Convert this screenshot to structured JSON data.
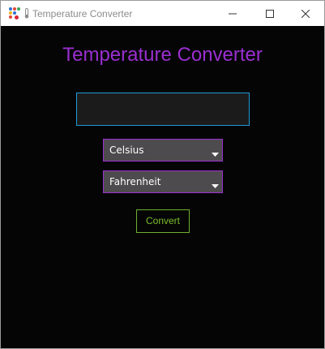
{
  "window": {
    "title": "Temperature Converter",
    "app_icon": "app-dots-icon",
    "title_prefix_icon": "thermometer-icon",
    "controls": [
      "minimize-icon",
      "maximize-icon",
      "close-icon"
    ]
  },
  "main": {
    "heading": "Temperature Converter",
    "temperature_input": {
      "value": "",
      "placeholder": ""
    },
    "from_unit": {
      "selected": "Celsius"
    },
    "to_unit": {
      "selected": "Fahrenheit"
    },
    "convert_label": "Convert"
  },
  "colors": {
    "background": "#050505",
    "heading": "#9a2fd0",
    "input_border": "#1f9ad6",
    "select_border": "#9a2fd0",
    "select_fill": "#4d4b4d",
    "button_accent": "#7bbf2c"
  }
}
